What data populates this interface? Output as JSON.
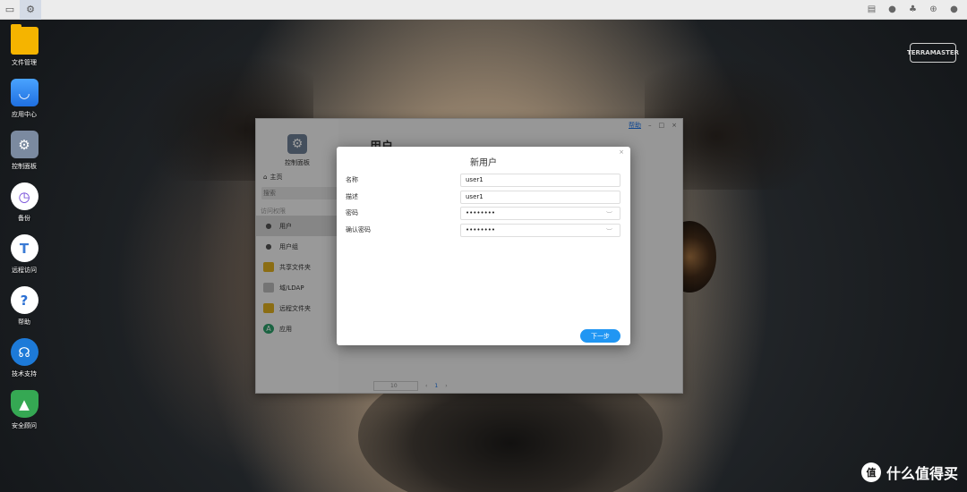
{
  "desktop": {
    "icons": [
      {
        "label": "文件管理",
        "icon": "folder-icon"
      },
      {
        "label": "应用中心",
        "icon": "app-store-icon"
      },
      {
        "label": "控制面板",
        "icon": "control-panel-icon"
      },
      {
        "label": "备份",
        "icon": "backup-icon"
      },
      {
        "label": "远程访问",
        "icon": "remote-access-icon"
      },
      {
        "label": "帮助",
        "icon": "help-icon"
      },
      {
        "label": "技术支持",
        "icon": "tech-support-icon"
      },
      {
        "label": "安全顾问",
        "icon": "security-icon"
      }
    ],
    "brand_logo": "TERRAMASTER",
    "watermark": "什么值得买",
    "watermark_mark": "值"
  },
  "taskbar": {
    "left_icons": [
      "desktop-icon",
      "control-panel-icon"
    ],
    "right_icons": [
      "message-icon",
      "chat-icon",
      "notification-bell-icon",
      "globe-icon",
      "user-icon"
    ]
  },
  "control_panel": {
    "title": "控制面板",
    "home": "主页",
    "search_placeholder": "搜索",
    "section_label": "访问权限",
    "nav_items": [
      {
        "label": "用户",
        "icon": "user-icon"
      },
      {
        "label": "用户组",
        "icon": "user-group-icon"
      },
      {
        "label": "共享文件夹",
        "icon": "shared-folder-icon"
      },
      {
        "label": "域/LDAP",
        "icon": "domain-icon"
      },
      {
        "label": "远程文件夹",
        "icon": "remote-folder-icon"
      },
      {
        "label": "应用",
        "icon": "apps-icon"
      }
    ],
    "active_nav": "用户",
    "page_title": "用户",
    "help_link": "帮助",
    "pager": {
      "page_size": "10",
      "current_page": "1"
    }
  },
  "modal": {
    "title": "新用户",
    "fields": [
      {
        "label": "名称",
        "value": "user1",
        "type": "text"
      },
      {
        "label": "描述",
        "value": "user1",
        "type": "text"
      },
      {
        "label": "密码",
        "value": "••••••••",
        "type": "password"
      },
      {
        "label": "确认密码",
        "value": "••••••••",
        "type": "password"
      }
    ],
    "next_button": "下一步"
  }
}
